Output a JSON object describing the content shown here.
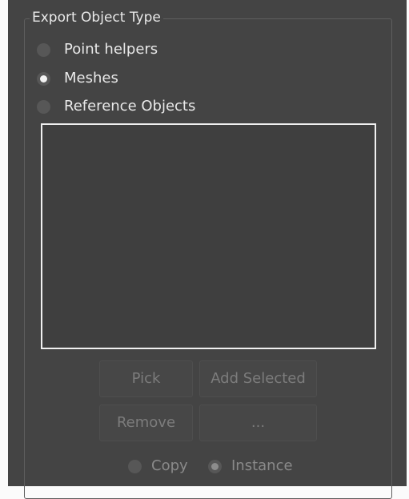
{
  "group": {
    "title": "Export Object Type"
  },
  "options": [
    {
      "label": "Point helpers",
      "checked": false
    },
    {
      "label": "Meshes",
      "checked": true
    },
    {
      "label": "Reference Objects",
      "checked": false
    }
  ],
  "buttons": {
    "pick": "Pick",
    "add_selected": "Add Selected",
    "remove": "Remove",
    "more": "..."
  },
  "mode": {
    "copy": {
      "label": "Copy",
      "checked": false
    },
    "instance": {
      "label": "Instance",
      "checked": true
    }
  }
}
